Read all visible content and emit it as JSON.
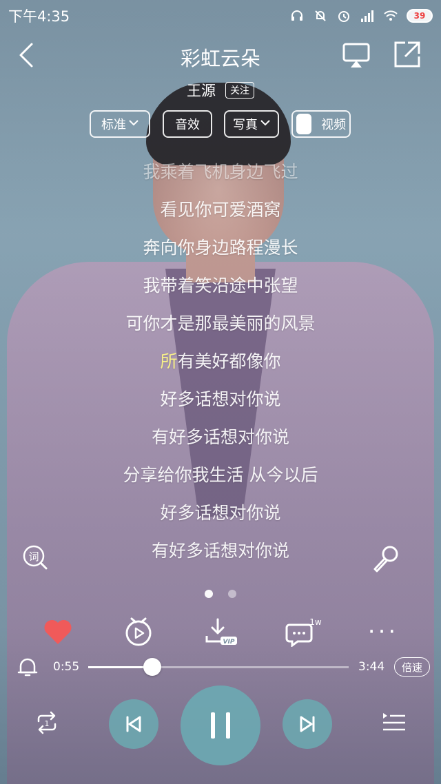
{
  "status_bar": {
    "time": "下午4:35",
    "battery": "39"
  },
  "header": {
    "title": "彩虹云朵",
    "artist": "王源",
    "follow_label": "关注"
  },
  "chips": {
    "quality": "标准",
    "effect": "音效",
    "photo": "写真",
    "video": "视频"
  },
  "lyrics": [
    {
      "text": "我乘着飞机身边飞过",
      "state": "dim"
    },
    {
      "text": "看见你可爱酒窝",
      "state": "normal"
    },
    {
      "text": "奔向你身边路程漫长",
      "state": "normal"
    },
    {
      "text": "我带着笑沿途中张望",
      "state": "normal"
    },
    {
      "text": "可你才是那最美丽的风景",
      "state": "normal"
    },
    {
      "text": "所有美好都像你",
      "state": "current"
    },
    {
      "text": "好多话想对你说",
      "state": "normal"
    },
    {
      "text": "有好多话想对你说",
      "state": "normal"
    },
    {
      "text": "分享给你我生活 从今以后",
      "state": "normal"
    },
    {
      "text": "好多话想对你说",
      "state": "normal"
    },
    {
      "text": "有好多话想对你说",
      "state": "normal"
    }
  ],
  "current_line": {
    "highlight": "所",
    "rest": "有美好都像你"
  },
  "comment_count": "1w",
  "download_badge": "VIP",
  "more_label": "···",
  "progress": {
    "current": "0:55",
    "total": "3:44",
    "fraction": 0.245,
    "speed_label": "倍速"
  },
  "colors": {
    "accent_button": "#6baab2",
    "heart": "#f05a5a",
    "lyric_highlight": "#f7f08a"
  }
}
